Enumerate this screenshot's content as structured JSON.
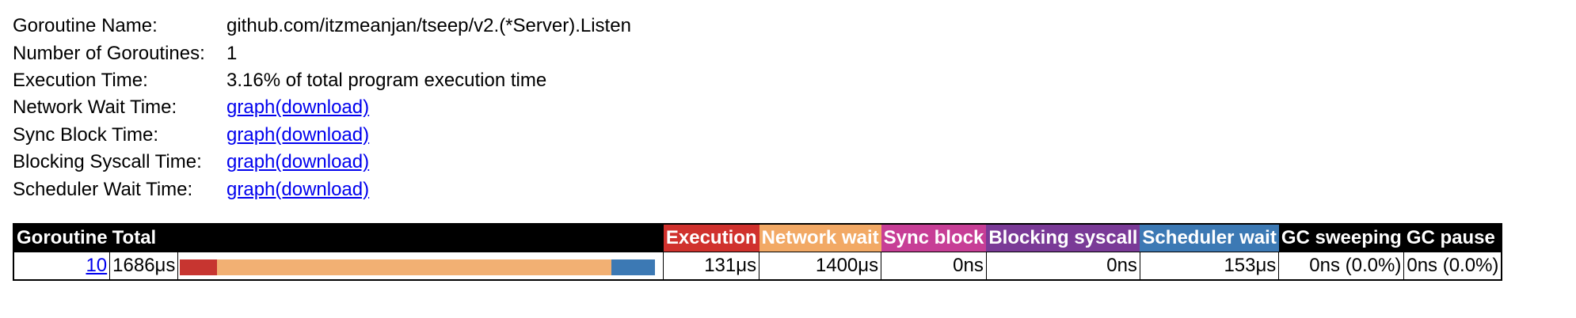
{
  "info": [
    {
      "key": "Goroutine Name:",
      "value": "github.com/itzmeanjan/tseep/v2.(*Server).Listen",
      "link": false
    },
    {
      "key": "Number of Goroutines:",
      "value": "1",
      "link": false
    },
    {
      "key": "Execution Time:",
      "value": "3.16% of total program execution time",
      "link": false
    },
    {
      "key": "Network Wait Time:",
      "value": "graph(download)",
      "link": true
    },
    {
      "key": "Sync Block Time:",
      "value": "graph(download)",
      "link": true
    },
    {
      "key": "Blocking Syscall Time:",
      "value": "graph(download)",
      "link": true
    },
    {
      "key": "Scheduler Wait Time:",
      "value": "graph(download)",
      "link": true
    }
  ],
  "table": {
    "headers": {
      "goroutine": "Goroutine",
      "total": "Total",
      "execution": "Execution",
      "network_wait": "Network wait",
      "sync_block": "Sync block",
      "blocking_syscall": "Blocking syscall",
      "scheduler_wait": "Scheduler wait",
      "gc_sweeping": "GC sweeping",
      "gc_pause": "GC pause"
    },
    "header_colors": {
      "execution": "#d0312d",
      "network_wait": "#f2a965",
      "sync_block": "#c73e96",
      "blocking_syscall": "#7a3a97",
      "scheduler_wait": "#3c79b4"
    },
    "row": {
      "goroutine": "10",
      "total": "1686μs",
      "execution": "131μs",
      "network_wait": "1400μs",
      "sync_block": "0ns",
      "blocking_syscall": "0ns",
      "scheduler_wait": "153μs",
      "gc_sweeping": "0ns (0.0%)",
      "gc_pause": "0ns (0.0%)"
    },
    "bar_fractions": [
      {
        "name": "execution",
        "fraction": 0.0777,
        "color": "#c73530"
      },
      {
        "name": "network_wait",
        "fraction": 0.8303,
        "color": "#f2b073"
      },
      {
        "name": "scheduler_wait",
        "fraction": 0.0907,
        "color": "#3c79b4"
      }
    ]
  }
}
